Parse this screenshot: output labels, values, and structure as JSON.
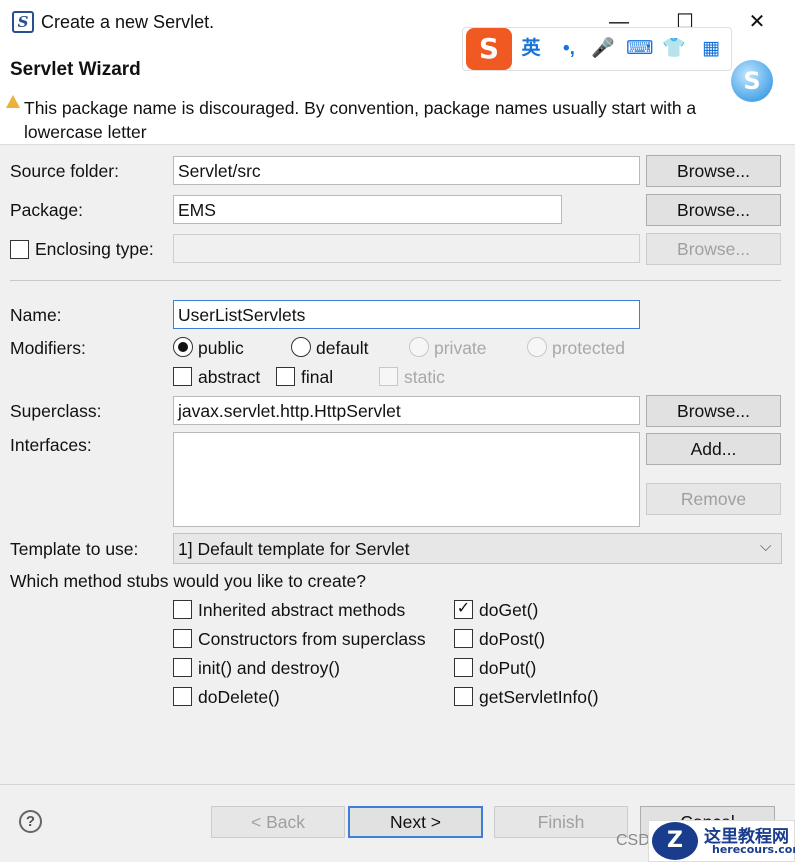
{
  "window": {
    "title": "Create a new Servlet.",
    "app_icon_glyph": "S",
    "min_glyph": "—",
    "max_glyph": "☐",
    "close_glyph": "✕"
  },
  "header": {
    "title": "Servlet Wizard",
    "warning": "This package name is discouraged. By convention, package names usually start with a lowercase letter"
  },
  "form": {
    "source_folder_label": "Source folder:",
    "source_folder_value": "Servlet/src",
    "package_label": "Package:",
    "package_value": "EMS",
    "enclosing_label": "Enclosing type:",
    "browse_label": "Browse...",
    "name_label": "Name:",
    "name_value": "UserListServlets",
    "modifiers_label": "Modifiers:",
    "modifiers": {
      "public": "public",
      "default": "default",
      "private": "private",
      "protected": "protected",
      "abstract": "abstract",
      "final": "final",
      "static": "static",
      "selected": "public"
    },
    "superclass_label": "Superclass:",
    "superclass_value": "javax.servlet.http.HttpServlet",
    "interfaces_label": "Interfaces:",
    "add_label": "Add...",
    "remove_label": "Remove",
    "template_label": "Template to use:",
    "template_value": "1] Default template for Servlet",
    "stubs_question": "Which method stubs would you like to create?",
    "stubs": {
      "inherited": "Inherited abstract methods",
      "constructors": "Constructors from superclass",
      "init_destroy": "init() and destroy()",
      "do_delete": "doDelete()",
      "do_get": "doGet()",
      "do_post": "doPost()",
      "do_put": "doPut()",
      "get_servlet_info": "getServletInfo()"
    },
    "checked_glyph": "✓"
  },
  "footer": {
    "help_glyph": "?",
    "back_label": "< Back",
    "next_label": "Next >",
    "finish_label": "Finish",
    "cancel_label": "Cancel"
  },
  "ime": {
    "logo": "S",
    "lang": "英",
    "punct": "•,",
    "mic": "🎤",
    "keyboard": "⌨",
    "skin": "👕",
    "apps": "▦",
    "ball": "S"
  },
  "watermark": {
    "logo": "Z",
    "title": "这里教程网",
    "url": "herecours.com",
    "csdn": "CSD"
  },
  "colors": {
    "accent": "#3b7fd8",
    "warning": "#e9b23a",
    "ime": "#f05a22"
  }
}
